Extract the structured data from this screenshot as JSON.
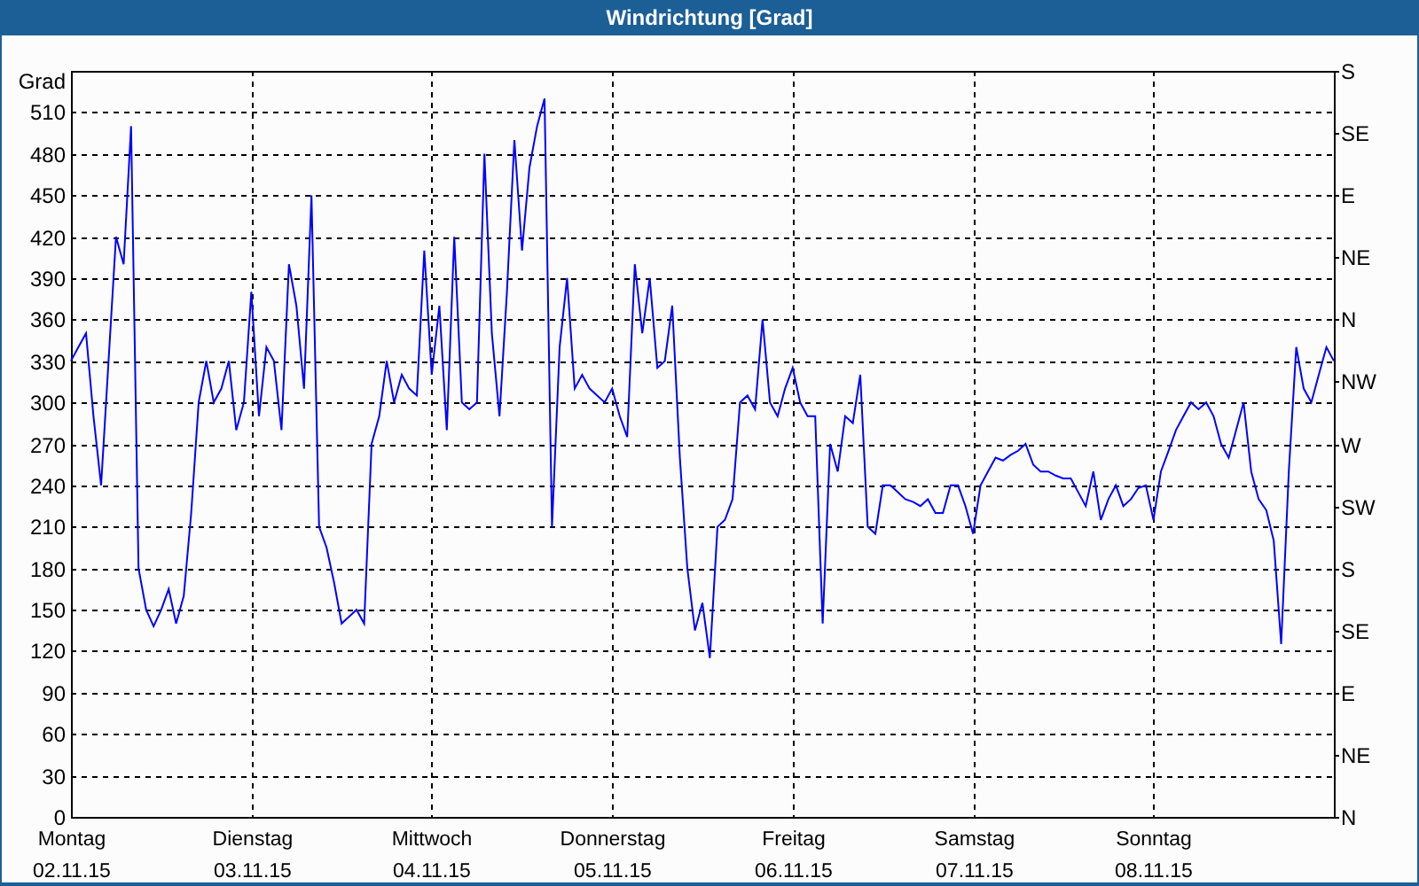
{
  "window": {
    "title": "Windrichtung [Grad]"
  },
  "chart": {
    "right_axis_labels": [
      "S",
      "SE",
      "E",
      "NE",
      "N",
      "NW",
      "W",
      "SW",
      "S",
      "SE",
      "E",
      "NE",
      "N"
    ],
    "chart_data": {
      "type": "line",
      "grid": true,
      "ylabel": "Grad",
      "ylim": [
        0,
        540
      ],
      "yticks": [
        0,
        30,
        60,
        90,
        120,
        150,
        180,
        210,
        240,
        270,
        300,
        330,
        360,
        390,
        420,
        450,
        480,
        510
      ],
      "categories": [
        "Montag\n02.11.15",
        null,
        null,
        null,
        null,
        null,
        null,
        null,
        null,
        null,
        null,
        null,
        null,
        null,
        null,
        null,
        null,
        null,
        null,
        null,
        null,
        null,
        null,
        null,
        "Dienstag\n03.11.15",
        null,
        null,
        null,
        null,
        null,
        null,
        null,
        null,
        null,
        null,
        null,
        null,
        null,
        null,
        null,
        null,
        null,
        null,
        null,
        null,
        null,
        null,
        null,
        "Mittwoch\n04.11.15",
        null,
        null,
        null,
        null,
        null,
        null,
        null,
        null,
        null,
        null,
        null,
        null,
        null,
        null,
        null,
        null,
        null,
        null,
        null,
        null,
        null,
        null,
        null,
        "Donnerstag\n05.11.15",
        null,
        null,
        null,
        null,
        null,
        null,
        null,
        null,
        null,
        null,
        null,
        null,
        null,
        null,
        null,
        null,
        null,
        null,
        null,
        null,
        null,
        null,
        null,
        "Freitag\n06.11.15",
        null,
        null,
        null,
        null,
        null,
        null,
        null,
        null,
        null,
        null,
        null,
        null,
        null,
        null,
        null,
        null,
        null,
        null,
        null,
        null,
        null,
        null,
        null,
        "Samstag\n07.11.15",
        null,
        null,
        null,
        null,
        null,
        null,
        null,
        null,
        null,
        null,
        null,
        null,
        null,
        null,
        null,
        null,
        null,
        null,
        null,
        null,
        null,
        null,
        null,
        "Sonntag\n08.11.15",
        null,
        null,
        null,
        null,
        null,
        null,
        null,
        null,
        null,
        null,
        null,
        null,
        null,
        null,
        null,
        null,
        null,
        null,
        null,
        null,
        null,
        null,
        null,
        null
      ],
      "series": [
        {
          "color": "#0000ff",
          "values": [
            330,
            340,
            350,
            290,
            240,
            330,
            420,
            400,
            500,
            180,
            150,
            138,
            150,
            165,
            140,
            160,
            220,
            300,
            330,
            300,
            310,
            330,
            280,
            300,
            380,
            290,
            340,
            330,
            280,
            400,
            370,
            310,
            450,
            210,
            195,
            170,
            140,
            145,
            150,
            140,
            270,
            290,
            330,
            300,
            320,
            310,
            305,
            410,
            320,
            370,
            280,
            420,
            300,
            295,
            300,
            480,
            350,
            290,
            380,
            490,
            410,
            470,
            500,
            520,
            210,
            340,
            390,
            310,
            320,
            310,
            305,
            300,
            310,
            290,
            275,
            400,
            350,
            390,
            325,
            330,
            370,
            260,
            180,
            135,
            155,
            115,
            210,
            215,
            230,
            300,
            305,
            295,
            360,
            300,
            290,
            310,
            325,
            300,
            290,
            290,
            140,
            270,
            250,
            290,
            285,
            320,
            210,
            205,
            240,
            240,
            235,
            230,
            228,
            225,
            230,
            220,
            220,
            240,
            240,
            225,
            205,
            240,
            250,
            260,
            258,
            262,
            265,
            270,
            255,
            250,
            250,
            247,
            245,
            245,
            235,
            225,
            250,
            215,
            230,
            240,
            225,
            230,
            238,
            240,
            215,
            250,
            265,
            280,
            290,
            300,
            295,
            300,
            290,
            270,
            260,
            280,
            300,
            250,
            230,
            222,
            200,
            125,
            250,
            340,
            310,
            300,
            320,
            340,
            330
          ]
        }
      ]
    }
  }
}
